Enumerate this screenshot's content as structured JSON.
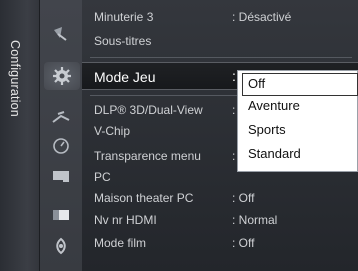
{
  "side_tab": {
    "label": "Configuration"
  },
  "icons": [
    "satellite-icon",
    "gear-icon",
    "antenna-icon",
    "clock-icon",
    "input-icon",
    "picture-icon",
    "sound-icon"
  ],
  "menu": {
    "rows": [
      {
        "label": "Minuterie 3",
        "value": ": Désactivé"
      },
      {
        "label": "Sous-titres",
        "value": ""
      },
      {
        "label": "Mode Jeu",
        "value": ":"
      },
      {
        "label": "DLP® 3D/Dual-View",
        "value": ":"
      },
      {
        "label": "V-Chip",
        "value": ""
      },
      {
        "label": "Transparence menu",
        "value": ":"
      },
      {
        "label": "PC",
        "value": ""
      },
      {
        "label": "Maison theater PC",
        "value": ": Off"
      },
      {
        "label": "Nv nr HDMI",
        "value": ": Normal"
      },
      {
        "label": "Mode film",
        "value": ": Off"
      }
    ]
  },
  "dropdown": {
    "options": [
      "Off",
      "Aventure",
      "Sports",
      "Standard"
    ],
    "selected": "Off"
  }
}
